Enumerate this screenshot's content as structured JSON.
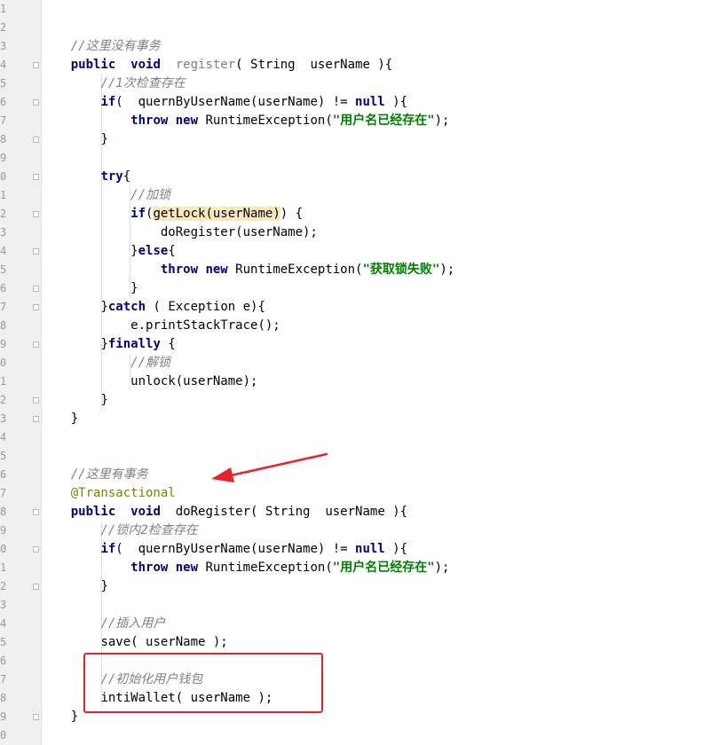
{
  "line_numbers": [
    "1",
    "2",
    "3",
    "4",
    "5",
    "6",
    "7",
    "8",
    "9",
    "0",
    "1",
    "2",
    "3",
    "4",
    "5",
    "6",
    "7",
    "8",
    "9",
    "0",
    "1",
    "2",
    "3",
    "4",
    "5",
    "6",
    "7",
    "8",
    "9",
    "0",
    "1",
    "2",
    "3",
    "4",
    "5",
    "6",
    "7",
    "8",
    "9",
    "0"
  ],
  "code": {
    "method1": {
      "comment": "//这里没有事务",
      "kw_public": "public",
      "kw_void": "void",
      "name": "register",
      "paren_open": "( ",
      "type": "String",
      "param": "  userName ){",
      "check_comment": "//1次检查存在",
      "if_kw": "if",
      "if_cond": "(  quernByUserName(userName) != ",
      "null": "null",
      "if_end": " ){",
      "throw_kw": "throw",
      "new_kw": "new",
      "exception": " RuntimeException(",
      "msg": "\"用户名已经存在\"",
      "throw_end": ");",
      "close_brace": "}",
      "try_kw": "try",
      "try_brace": "{",
      "lock_comment": "//加锁",
      "if2_kw": "if",
      "if2_open": "(",
      "getlock": "getLock(userName)",
      "if2_end": ") {",
      "do_register": "doRegister(userName);",
      "else_open": "}",
      "else_kw": "else",
      "else_brace": "{",
      "throw2_kw": "throw",
      "new2_kw": "new",
      "exception2": " RuntimeException(",
      "msg2": "\"获取锁失败\"",
      "throw2_end": ");",
      "close_inner": "}",
      "catch_open": "}",
      "catch_kw": "catch",
      "catch_rest": " ( Exception e){",
      "print_trace": "e.printStackTrace();",
      "finally_open": "}",
      "finally_kw": "finally",
      "finally_rest": " {",
      "unlock_comment": "//解锁",
      "unlock": "unlock(userName);",
      "close_finally": "}",
      "close_method": "}"
    },
    "method2": {
      "comment": "//这里有事务",
      "annotation": "@Transactional",
      "kw_public": "public",
      "kw_void": "void",
      "name": "doRegister",
      "paren_open": "( ",
      "type": "String",
      "param": "  userName ){",
      "check_comment": "//锁内2检查存在",
      "if_kw": "if",
      "if_cond": "(  quernByUserName(userName) != ",
      "null": "null",
      "if_end": " ){",
      "throw_kw": "throw",
      "new_kw": "new",
      "exception": " RuntimeException(",
      "msg": "\"用户名已经存在\"",
      "throw_end": ");",
      "close_brace": "}",
      "insert_comment": "//插入用户",
      "save": "save( userName );",
      "wallet_comment": "//初始化用户钱包",
      "init_wallet": "intiWallet( userName );",
      "close_method": "}"
    }
  },
  "colors": {
    "keyword": "#000080",
    "comment": "#808080",
    "string": "#008000",
    "annotation": "#808000",
    "highlight": "#f7eab8",
    "markup_red": "#e8232a"
  },
  "markup": {
    "arrow": "red-arrow",
    "box": "red-box"
  }
}
